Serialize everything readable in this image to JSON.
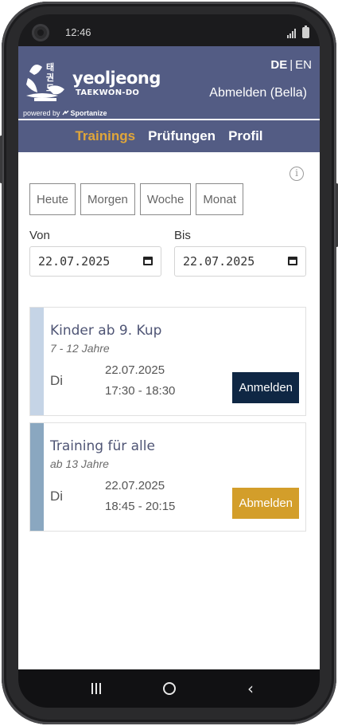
{
  "status_bar": {
    "time": "12:46"
  },
  "header": {
    "brand_word": "yeoljeong",
    "brand_sub": "TAEKWON-DO",
    "hangul": [
      "태",
      "권",
      "도"
    ],
    "powered_prefix": "powered by",
    "powered_brand": "Sportanize",
    "languages": [
      "DE",
      "EN"
    ],
    "active_language": "DE",
    "logout_text": "Abmelden (Bella)"
  },
  "nav": {
    "items": [
      {
        "label": "Trainings",
        "active": true
      },
      {
        "label": "Prüfungen",
        "active": false
      },
      {
        "label": "Profil",
        "active": false
      }
    ]
  },
  "filters": {
    "info_icon": "info-icon",
    "ranges": [
      "Heute",
      "Morgen",
      "Woche",
      "Monat"
    ],
    "from_label": "Von",
    "from_value": "22.07.2025",
    "to_label": "Bis",
    "to_value": "22.07.2025"
  },
  "trainings": [
    {
      "title": "Kinder ab 9. Kup",
      "age": "7 - 12 Jahre",
      "day": "Di",
      "date": "22.07.2025",
      "time": "17:30 - 18:30",
      "action": "Anmelden",
      "bar_color": "#c5d4e6",
      "action_color": "#0f2744"
    },
    {
      "title": "Training für alle",
      "age": "ab 13 Jahre",
      "day": "Di",
      "date": "22.07.2025",
      "time": "18:45 - 20:15",
      "action": "Abmelden",
      "bar_color": "#8aa7c0",
      "action_color": "#d39e2a"
    }
  ],
  "colors": {
    "header_bg": "#535c84",
    "nav_active": "#e0a63a"
  }
}
